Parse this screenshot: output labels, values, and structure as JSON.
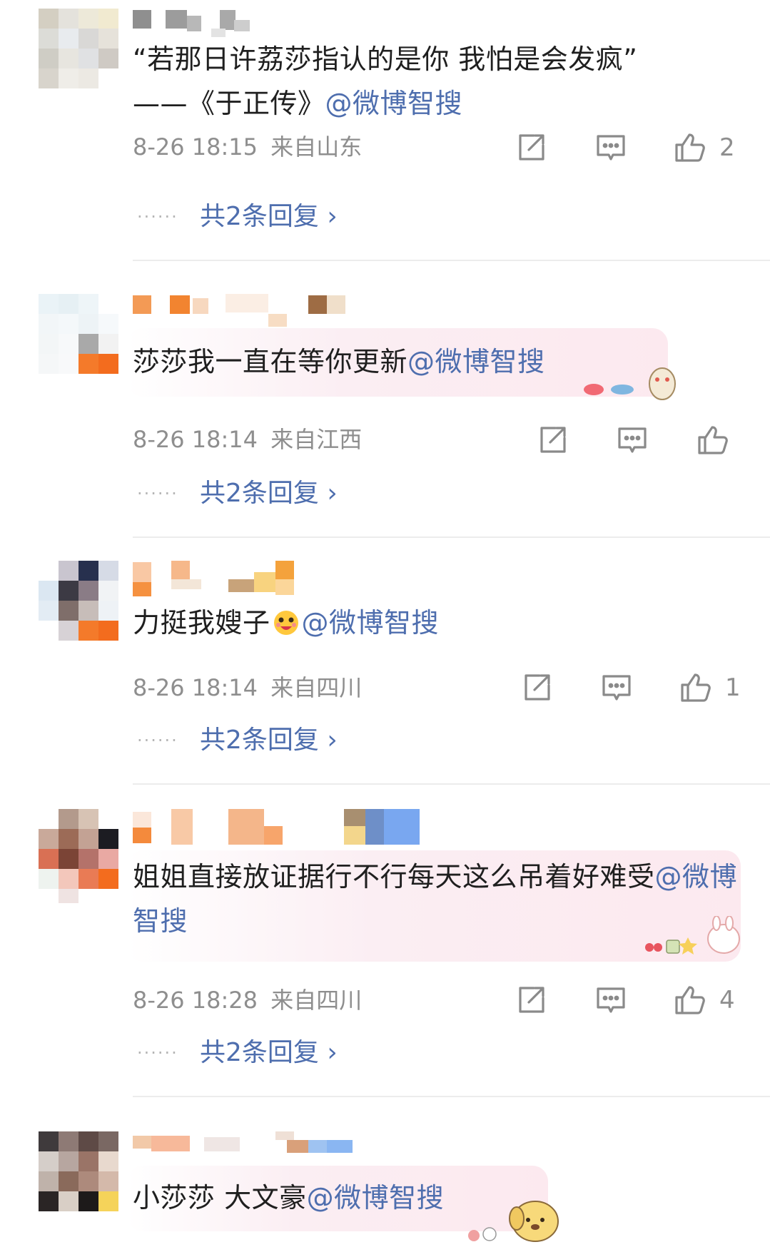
{
  "colors": {
    "link": "#4e6eae",
    "meta": "#8e8e8e",
    "text": "#1f1f1f"
  },
  "comments": [
    {
      "text_before": "“若那日许荔莎指认的是你 我怕是会发疯”\n——《于正传》",
      "mention": "@微博智搜",
      "time": "8-26 18:15",
      "location": "来自山东",
      "like_count": "2",
      "replies": "共2条回复 ›"
    },
    {
      "text_before": "莎莎我一直在等你更新",
      "mention": "@微博智搜",
      "time": "8-26 18:14",
      "location": "来自江西",
      "like_count": "",
      "replies": "共2条回复 ›"
    },
    {
      "text_before": "力挺我嫂子",
      "emoji": "emoji-face",
      "mention": "@微博智搜",
      "time": "8-26 18:14",
      "location": "来自四川",
      "like_count": "1",
      "replies": "共2条回复 ›"
    },
    {
      "text_before": "姐姐直接放证据行不行每天这么吊着好难受",
      "mention": "@微博智搜",
      "time": "8-26 18:28",
      "location": "来自四川",
      "like_count": "4",
      "replies": "共2条回复 ›"
    },
    {
      "text_before": "小莎莎 大文豪",
      "mention": "@微博智搜"
    }
  ]
}
